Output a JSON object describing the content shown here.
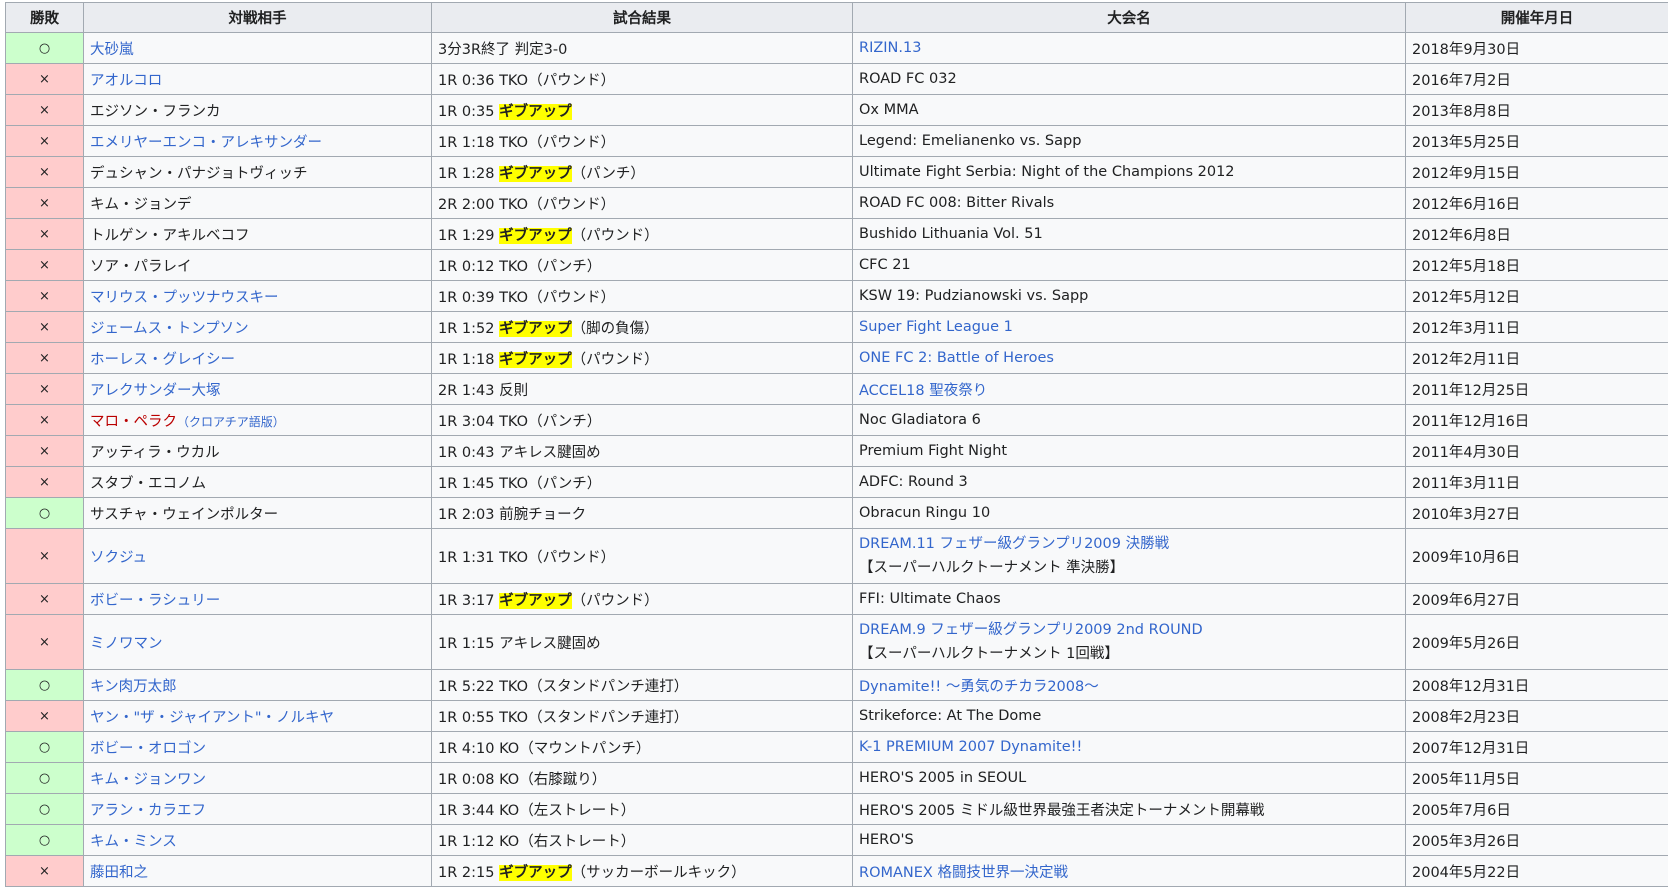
{
  "headers": [
    "勝敗",
    "対戦相手",
    "試合結果",
    "大会名",
    "開催年月日"
  ],
  "symbols": {
    "win": "○",
    "loss": "×"
  },
  "colors": {
    "win_bg": "#ccffcc",
    "loss_bg": "#ffcccc",
    "link": "#3366cc",
    "redlink": "#ba0000",
    "highlight": "#ffff00"
  },
  "rows": [
    {
      "res": "win",
      "opp": "大砂嵐",
      "opp_link": true,
      "result_a": "3分3R終了 判定3-0",
      "event": "RIZIN.13",
      "event_link": true,
      "date": "2018年9月30日"
    },
    {
      "res": "loss",
      "opp": "アオルコロ",
      "opp_link": true,
      "result_a": "1R 0:36 TKO（パウンド）",
      "event": "ROAD FC 032",
      "date": "2016年7月2日"
    },
    {
      "res": "loss",
      "opp": "エジソン・フランカ",
      "result_a": "1R 0:35 ",
      "result_hl": "ギブアップ",
      "event": "Ox MMA",
      "date": "2013年8月8日"
    },
    {
      "res": "loss",
      "opp": "エメリヤーエンコ・アレキサンダー",
      "opp_link": true,
      "result_a": "1R 1:18 TKO（パウンド）",
      "event": "Legend: Emelianenko vs. Sapp",
      "date": "2013年5月25日"
    },
    {
      "res": "loss",
      "opp": "デュシャン・パナジョトヴィッチ",
      "result_a": "1R 1:28 ",
      "result_hl": "ギブアップ",
      "result_b": "（パンチ）",
      "event": "Ultimate Fight Serbia: Night of the Champions 2012",
      "date": "2012年9月15日"
    },
    {
      "res": "loss",
      "opp": "キム・ジョンデ",
      "result_a": "2R 2:00 TKO（パウンド）",
      "event": "ROAD FC 008: Bitter Rivals",
      "date": "2012年6月16日"
    },
    {
      "res": "loss",
      "opp": "トルゲン・アキルベコフ",
      "result_a": "1R 1:29 ",
      "result_hl": "ギブアップ",
      "result_b": "（パウンド）",
      "event": "Bushido Lithuania Vol. 51",
      "date": "2012年6月8日"
    },
    {
      "res": "loss",
      "opp": "ソア・パラレイ",
      "result_a": "1R 0:12 TKO（パンチ）",
      "event": "CFC 21",
      "date": "2012年5月18日"
    },
    {
      "res": "loss",
      "opp": "マリウス・プッツナウスキー",
      "opp_link": true,
      "result_a": "1R 0:39 TKO（パウンド）",
      "event": "KSW 19: Pudzianowski vs. Sapp",
      "date": "2012年5月12日"
    },
    {
      "res": "loss",
      "opp": "ジェームス・トンプソン",
      "opp_link": true,
      "result_a": "1R 1:52 ",
      "result_hl": "ギブアップ",
      "result_b": "（脚の負傷）",
      "event": "Super Fight League 1",
      "event_link": true,
      "date": "2012年3月11日"
    },
    {
      "res": "loss",
      "opp": "ホーレス・グレイシー",
      "opp_link": true,
      "result_a": "1R 1:18 ",
      "result_hl": "ギブアップ",
      "result_b": "（パウンド）",
      "event": "ONE FC 2: Battle of Heroes",
      "event_link": true,
      "date": "2012年2月11日"
    },
    {
      "res": "loss",
      "opp": "アレクサンダー大塚",
      "opp_link": true,
      "result_a": "2R 1:43 反則",
      "event": "ACCEL18 聖夜祭り",
      "event_link": true,
      "date": "2011年12月25日"
    },
    {
      "res": "loss",
      "opp": "マロ・ペラク",
      "opp_redlink": true,
      "opp_note": "（クロアチア語版）",
      "result_a": "1R 3:04 TKO（パンチ）",
      "event": "Noc Gladiatora 6",
      "date": "2011年12月16日"
    },
    {
      "res": "loss",
      "opp": "アッティラ・ウカル",
      "result_a": "1R 0:43 アキレス腱固め",
      "event": "Premium Fight Night",
      "date": "2011年4月30日"
    },
    {
      "res": "loss",
      "opp": "スタブ・エコノム",
      "result_a": "1R 1:45 TKO（パンチ）",
      "event": "ADFC: Round 3",
      "date": "2011年3月11日"
    },
    {
      "res": "win",
      "opp": "サスチャ・ウェインポルター",
      "result_a": "1R 2:03 前腕チョーク",
      "event": "Obracun Ringu 10",
      "date": "2010年3月27日"
    },
    {
      "res": "loss",
      "opp": "ソクジュ",
      "opp_link": true,
      "result_a": "1R 1:31 TKO（パウンド）",
      "event": "DREAM.11 フェザー級グランプリ2009 決勝戦",
      "event_link": true,
      "event_note": "【スーパーハルクトーナメント 準決勝】",
      "date": "2009年10月6日"
    },
    {
      "res": "loss",
      "opp": "ボビー・ラシュリー",
      "opp_link": true,
      "result_a": "1R 3:17 ",
      "result_hl": "ギブアップ",
      "result_b": "（パウンド）",
      "event": "FFI: Ultimate Chaos",
      "date": "2009年6月27日"
    },
    {
      "res": "loss",
      "opp": "ミノワマン",
      "opp_link": true,
      "result_a": "1R 1:15 アキレス腱固め",
      "event": "DREAM.9 フェザー級グランプリ2009 2nd ROUND",
      "event_link": true,
      "event_note": "【スーパーハルクトーナメント 1回戦】",
      "date": "2009年5月26日"
    },
    {
      "res": "win",
      "opp": "キン肉万太郎",
      "opp_link": true,
      "result_a": "1R 5:22 TKO（スタンドパンチ連打）",
      "event": "Dynamite!! 〜勇気のチカラ2008〜",
      "event_link": true,
      "date": "2008年12月31日"
    },
    {
      "res": "loss",
      "opp": "ヤン・\"ザ・ジャイアント\"・ノルキヤ",
      "opp_link": true,
      "result_a": "1R 0:55 TKO（スタンドパンチ連打）",
      "event": "Strikeforce: At The Dome",
      "date": "2008年2月23日"
    },
    {
      "res": "win",
      "opp": "ボビー・オロゴン",
      "opp_link": true,
      "result_a": "1R 4:10 KO（マウントパンチ）",
      "event": "K-1 PREMIUM 2007 Dynamite!!",
      "event_link": true,
      "date": "2007年12月31日"
    },
    {
      "res": "win",
      "opp": "キム・ジョンワン",
      "opp_link": true,
      "result_a": "1R 0:08 KO（右膝蹴り）",
      "event": "HERO'S 2005 in SEOUL",
      "date": "2005年11月5日"
    },
    {
      "res": "win",
      "opp": "アラン・カラエフ",
      "opp_link": true,
      "result_a": "1R 3:44 KO（左ストレート）",
      "event": "HERO'S 2005 ミドル級世界最強王者決定トーナメント開幕戦",
      "date": "2005年7月6日"
    },
    {
      "res": "win",
      "opp": "キム・ミンス",
      "opp_link": true,
      "result_a": "1R 1:12 KO（右ストレート）",
      "event": "HERO'S",
      "date": "2005年3月26日"
    },
    {
      "res": "loss",
      "opp": "藤田和之",
      "opp_link": true,
      "result_a": "1R 2:15 ",
      "result_hl": "ギブアップ",
      "result_b": "（サッカーボールキック）",
      "event": "ROMANEX 格闘技世界一決定戦",
      "event_link": true,
      "date": "2004年5月22日"
    }
  ]
}
